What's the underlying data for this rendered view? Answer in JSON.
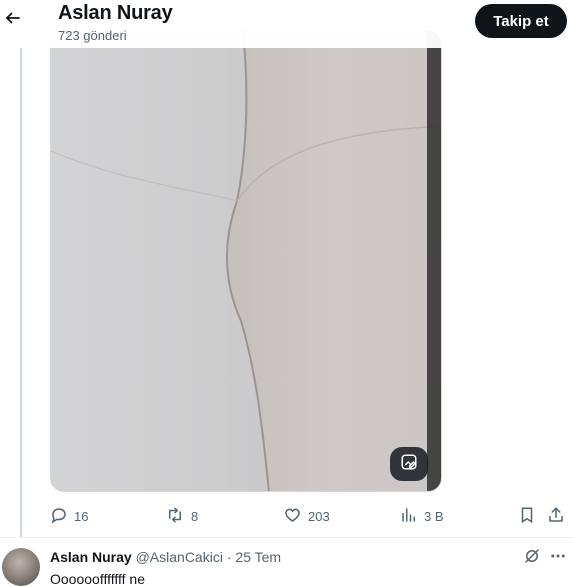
{
  "header": {
    "title": "Aslan Nuray",
    "subtitle": "723 gönderi",
    "follow_label": "Takip et"
  },
  "tweet": {
    "actions": {
      "replies": "16",
      "retweets": "8",
      "likes": "203",
      "views": "3 B"
    }
  },
  "reply": {
    "name": "Aslan Nuray",
    "handle": "@AslanCakici",
    "separator": "·",
    "date": "25 Tem",
    "text": "Oooooofffffff ne"
  },
  "icons": {
    "back": "arrow-left-icon",
    "alt_text": "image-edit-icon",
    "reply": "comment-icon",
    "retweet": "retweet-icon",
    "like": "heart-icon",
    "views": "bar-chart-icon",
    "bookmark": "bookmark-icon",
    "share": "share-icon",
    "grok": "grok-icon",
    "more": "more-dots-icon"
  },
  "colors": {
    "text_primary": "#0f1419",
    "text_secondary": "#536471",
    "follow_bg": "#0f1419",
    "divider": "#eff3f4",
    "thread_line": "#cfd9de"
  }
}
